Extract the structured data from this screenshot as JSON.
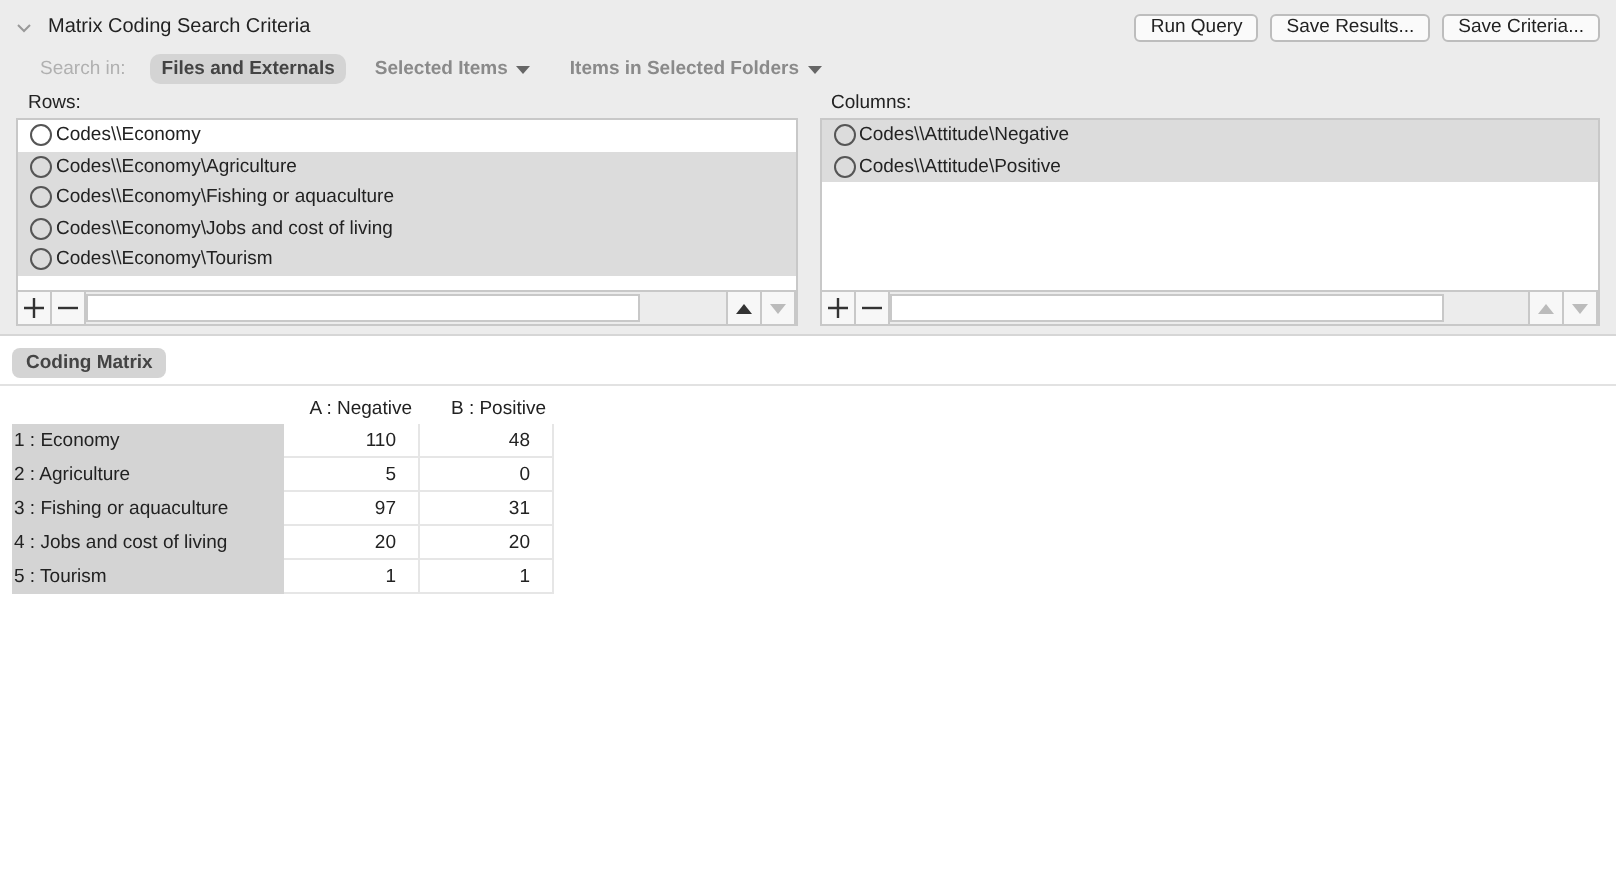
{
  "panel": {
    "title": "Matrix Coding Search Criteria",
    "expanded": true,
    "buttons": [
      "Run Query",
      "Save Results...",
      "Save Criteria..."
    ],
    "search_in": {
      "label": "Search in:",
      "options": [
        {
          "label": "Files and Externals",
          "selected": true,
          "dropdown": false
        },
        {
          "label": "Selected Items",
          "selected": false,
          "dropdown": true
        },
        {
          "label": "Items in Selected Folders",
          "selected": false,
          "dropdown": true
        }
      ]
    },
    "rows": {
      "label": "Rows:",
      "items": [
        {
          "label": "Codes\\\\Economy",
          "selected": false
        },
        {
          "label": "Codes\\\\Economy\\Agriculture",
          "selected": true
        },
        {
          "label": "Codes\\\\Economy\\Fishing or aquaculture",
          "selected": true
        },
        {
          "label": "Codes\\\\Economy\\Jobs and cost of living",
          "selected": true
        },
        {
          "label": "Codes\\\\Economy\\Tourism",
          "selected": true
        }
      ],
      "move_up_disabled": false
    },
    "columns": {
      "label": "Columns:",
      "items": [
        {
          "label": "Codes\\\\Attitude\\Negative",
          "selected": true
        },
        {
          "label": "Codes\\\\Attitude\\Positive",
          "selected": true
        }
      ],
      "move_up_disabled": true
    }
  },
  "tab": {
    "label": "Coding Matrix"
  },
  "matrix": {
    "columns": [
      "A : Negative",
      "B : Positive"
    ],
    "rows": [
      {
        "label": "1 : Economy",
        "values": [
          "110",
          "48"
        ]
      },
      {
        "label": "2 : Agriculture",
        "values": [
          "5",
          "0"
        ]
      },
      {
        "label": "3 : Fishing or aquaculture",
        "values": [
          "97",
          "31"
        ]
      },
      {
        "label": "4 : Jobs and cost of living",
        "values": [
          "20",
          "20"
        ]
      },
      {
        "label": "5 : Tourism",
        "values": [
          "1",
          "1"
        ]
      }
    ]
  }
}
